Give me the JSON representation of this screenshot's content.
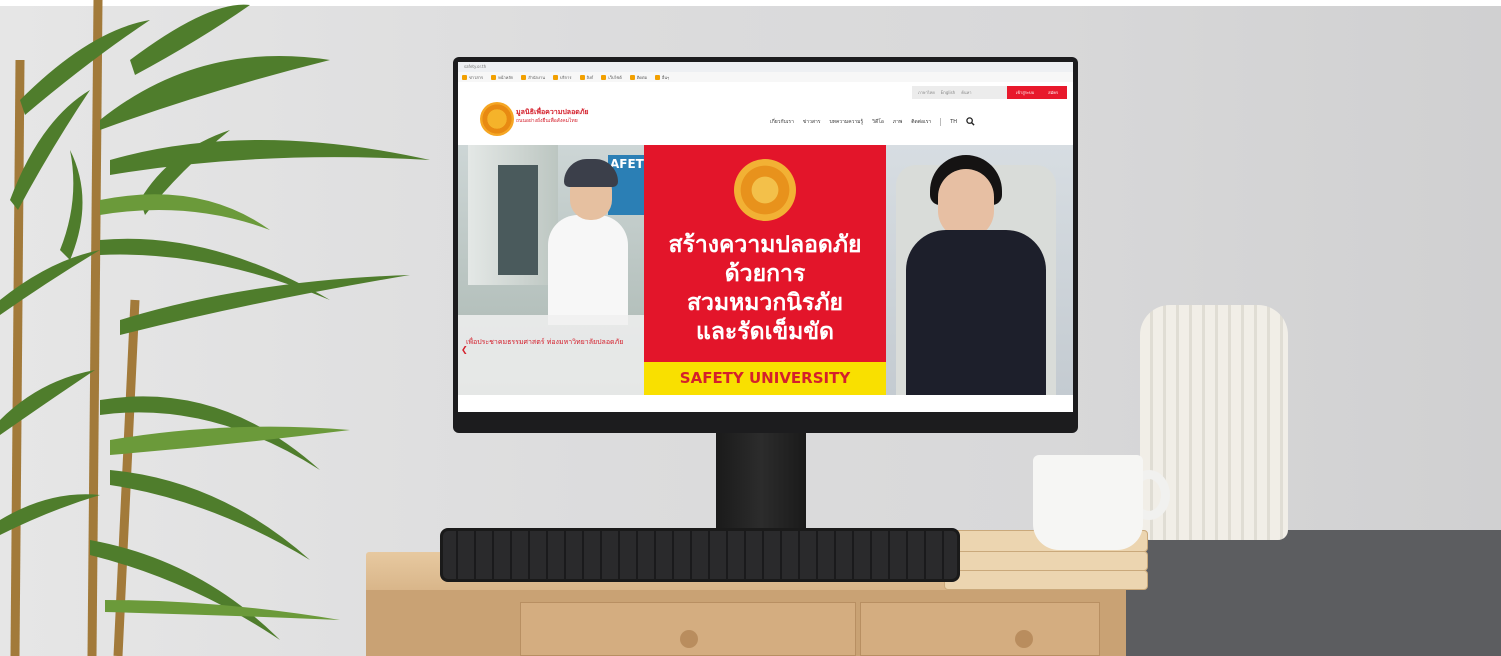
{
  "browser": {
    "url": "safety.or.th",
    "bookmarks": [
      "ข่าวสาร",
      "หน้าหลัก",
      "สำนักงาน",
      "บริการ",
      "ลิงก์",
      "เว็บไซต์",
      "ติดต่อ",
      "อื่นๆ"
    ]
  },
  "site": {
    "top_links": [
      "ภาษาไทย",
      "English",
      "ค้นหา"
    ],
    "top_buttons": [
      "เข้าสู่ระบบ",
      "สมัคร"
    ],
    "logo_line1": "มูลนิธิเพื่อความปลอดภัย",
    "logo_line2": "ถนนอย่างยั่งยืนเพื่อสังคมไทย",
    "nav": [
      "เกี่ยวกับเรา",
      "ข่าวสาร",
      "บทความความรู้",
      "วิดีโอ",
      "ภาพ",
      "ติดต่อเรา",
      "TH"
    ]
  },
  "hero": {
    "left_sign": "AFETY",
    "left_caption": "เพื่อประชาคมธรรมศาสตร์ ท่องมหาวิทยาลัยปลอดภัย",
    "headline_lines": [
      "สร้างความปลอดภัย",
      "ด้วยการ",
      "สวมหมวกนิรภัย",
      "และรัดเข็มขัด"
    ],
    "banner": "SAFETY UNIVERSITY"
  },
  "colors": {
    "brand_red": "#e3152a",
    "banner_yellow": "#f9e000",
    "seal_orange": "#f2a21f"
  }
}
